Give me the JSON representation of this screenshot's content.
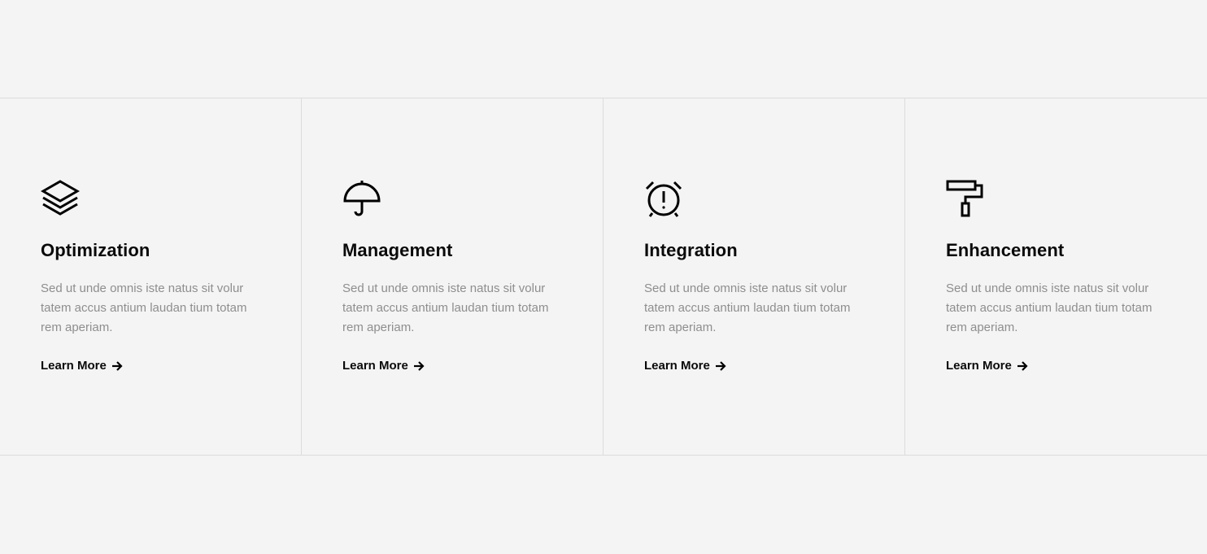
{
  "features": [
    {
      "icon": "layers-icon",
      "title": "Optimization",
      "description": "Sed ut unde omnis iste natus sit volur tatem accus antium laudan tium totam rem aperiam.",
      "link_label": "Learn More"
    },
    {
      "icon": "umbrella-icon",
      "title": "Management",
      "description": "Sed ut unde omnis iste natus sit volur tatem accus antium laudan tium totam rem aperiam.",
      "link_label": "Learn More"
    },
    {
      "icon": "alarm-clock-alert-icon",
      "title": "Integration",
      "description": "Sed ut unde omnis iste natus sit volur tatem accus antium laudan tium totam rem aperiam.",
      "link_label": "Learn More"
    },
    {
      "icon": "paint-roller-icon",
      "title": "Enhancement",
      "description": "Sed ut unde omnis iste natus sit volur tatem accus antium laudan tium totam rem aperiam.",
      "link_label": "Learn More"
    }
  ],
  "colors": {
    "background": "#f4f4f4",
    "divider": "#dcdcdc",
    "heading": "#0a0a0a",
    "body_text": "#8e8e8e"
  }
}
